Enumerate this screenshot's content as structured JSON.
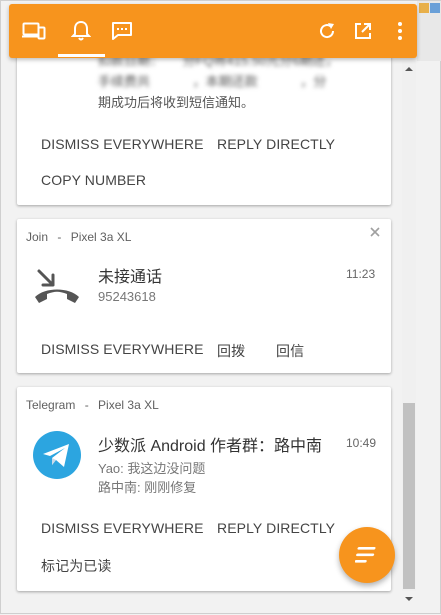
{
  "toolbar": {
    "tabs": [
      {
        "icon": "devices-icon"
      },
      {
        "icon": "bell-icon"
      },
      {
        "icon": "chat-icon"
      }
    ],
    "actions": [
      {
        "icon": "refresh-icon"
      },
      {
        "icon": "open-external-icon"
      },
      {
        "icon": "more-vert-icon"
      }
    ],
    "accent": "#f7941d"
  },
  "cards": {
    "first": {
      "blurred_line1": "扣款日期：　　分FQ将415.50元分6期还，",
      "blurred_line2": "手续费共 　　　，本期还款 　　　，分",
      "body_line3": "期成功后将收到短信通知。",
      "actions": [
        "DISMISS EVERYWHERE",
        "REPLY DIRECTLY",
        "COPY NUMBER"
      ]
    },
    "join": {
      "source": "Join",
      "sep": "-",
      "device": "Pixel 3a XL",
      "title": "未接通话",
      "subtitle": "95243618",
      "time": "11:23",
      "actions": [
        "DISMISS EVERYWHERE",
        "回拨",
        "回信"
      ]
    },
    "telegram": {
      "source": "Telegram",
      "sep": "-",
      "device": "Pixel 3a XL",
      "title": "少数派 Android 作者群：路中南",
      "line1": "Yao: 我这边没问题",
      "line2": "路中南: 刚刚修复",
      "time": "10:49",
      "actions": [
        "DISMISS EVERYWHERE",
        "REPLY DIRECTLY",
        "标记为已读"
      ]
    }
  },
  "fab": {
    "icon": "notes-icon"
  }
}
